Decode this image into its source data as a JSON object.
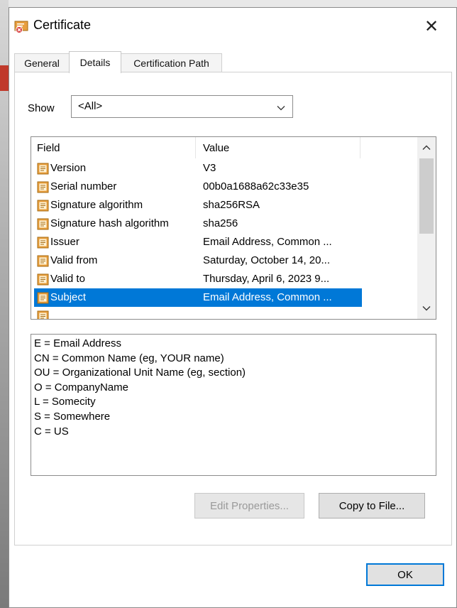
{
  "window": {
    "title": "Certificate",
    "close_glyph": "✕"
  },
  "tabs": [
    {
      "label": "General"
    },
    {
      "label": "Details"
    },
    {
      "label": "Certification Path"
    }
  ],
  "active_tab": "Details",
  "show": {
    "label": "Show",
    "selected": "<All>"
  },
  "field_list": {
    "headers": {
      "field": "Field",
      "value": "Value"
    },
    "rows": [
      {
        "field": "Version",
        "value": "V3"
      },
      {
        "field": "Serial number",
        "value": "00b0a1688a62c33e35"
      },
      {
        "field": "Signature algorithm",
        "value": "sha256RSA"
      },
      {
        "field": "Signature hash algorithm",
        "value": "sha256"
      },
      {
        "field": "Issuer",
        "value": "Email Address, Common ..."
      },
      {
        "field": "Valid from",
        "value": "Saturday, October 14, 20..."
      },
      {
        "field": "Valid to",
        "value": "Thursday, April 6, 2023 9..."
      },
      {
        "field": "Subject",
        "value": "Email Address, Common ..."
      }
    ],
    "selected_row": "Subject"
  },
  "detail_lines": [
    "E = Email Address",
    "CN = Common Name (eg, YOUR name)",
    "OU = Organizational Unit Name (eg, section)",
    "O = CompanyName",
    "L = Somecity",
    "S = Somewhere",
    "C = US"
  ],
  "buttons": {
    "edit_properties": "Edit Properties...",
    "copy_to_file": "Copy to File...",
    "ok": "OK"
  },
  "colors": {
    "selection": "#0078d7",
    "field_icon": "#e8a040"
  },
  "icons": {
    "title": "certificate-icon",
    "field": "document-field-icon",
    "scroll_up": "chevron-up-icon",
    "scroll_down": "chevron-down-icon",
    "dropdown": "chevron-down-icon"
  }
}
